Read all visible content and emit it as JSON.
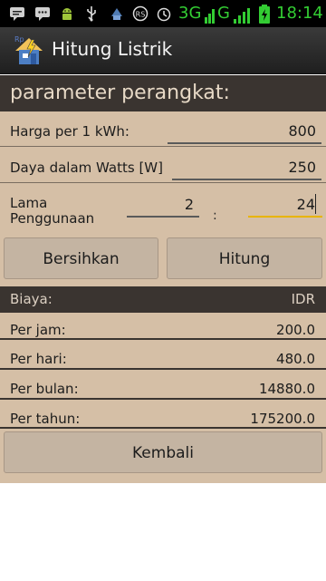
{
  "status_bar": {
    "network": "3G",
    "signal": "G",
    "time": "18:14"
  },
  "app": {
    "title": "Hitung Listrik",
    "icon": "app-house-icon"
  },
  "params": {
    "heading": "parameter perangkat:",
    "price_label": "Harga per 1 kWh:",
    "price_value": "800",
    "power_label": "Daya dalam Watts [W]",
    "power_value": "250",
    "duration_label": "Lama Penggunaan",
    "duration_hours": "2",
    "duration_sep": ":",
    "duration_total": "24"
  },
  "buttons": {
    "clear": "Bersihkan",
    "calculate": "Hitung",
    "back": "Kembali"
  },
  "results": {
    "header_left": "Biaya:",
    "header_right": "IDR",
    "rows": [
      {
        "label": "Per jam:",
        "value": "200.0"
      },
      {
        "label": "Per hari:",
        "value": "480.0"
      },
      {
        "label": "Per bulan:",
        "value": "14880.0"
      },
      {
        "label": "Per tahun:",
        "value": "175200.0"
      }
    ]
  }
}
